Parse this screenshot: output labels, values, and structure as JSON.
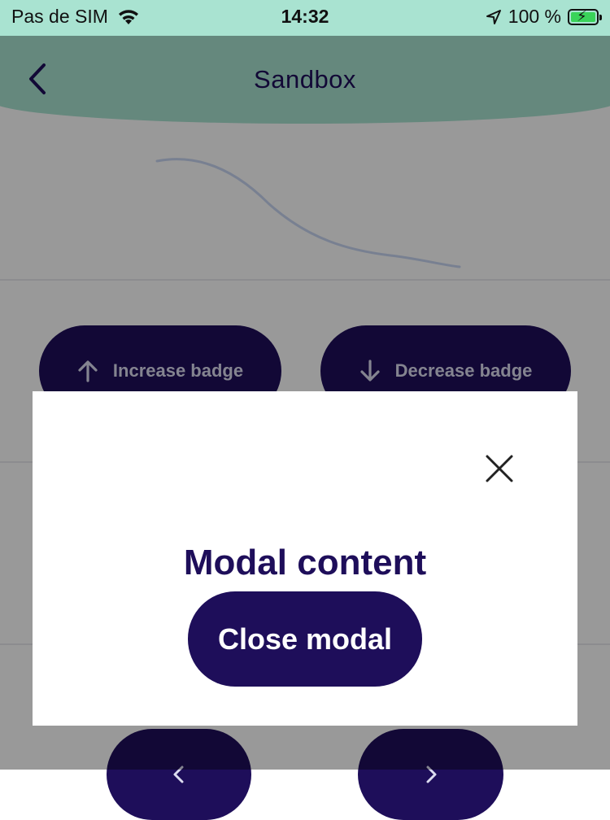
{
  "status_bar": {
    "carrier": "Pas de SIM",
    "time": "14:32",
    "battery": "100 %",
    "battery_level": 1.0,
    "icons": [
      "wifi-icon",
      "location-arrow-icon",
      "battery-charging-icon"
    ]
  },
  "header": {
    "title": "Sandbox",
    "back_icon": "chevron-left-icon",
    "background_color": "#a9e3d1"
  },
  "buttons": {
    "increase_badge": "Increase badge",
    "decrease_badge": "Decrease badge"
  },
  "modal": {
    "title": "Modal content",
    "close_button": "Close modal",
    "close_icon": "close-x-icon"
  },
  "colors": {
    "primary": "#1e0e5a",
    "accent": "#a9e3d1",
    "curve": "#c9d6f2"
  }
}
